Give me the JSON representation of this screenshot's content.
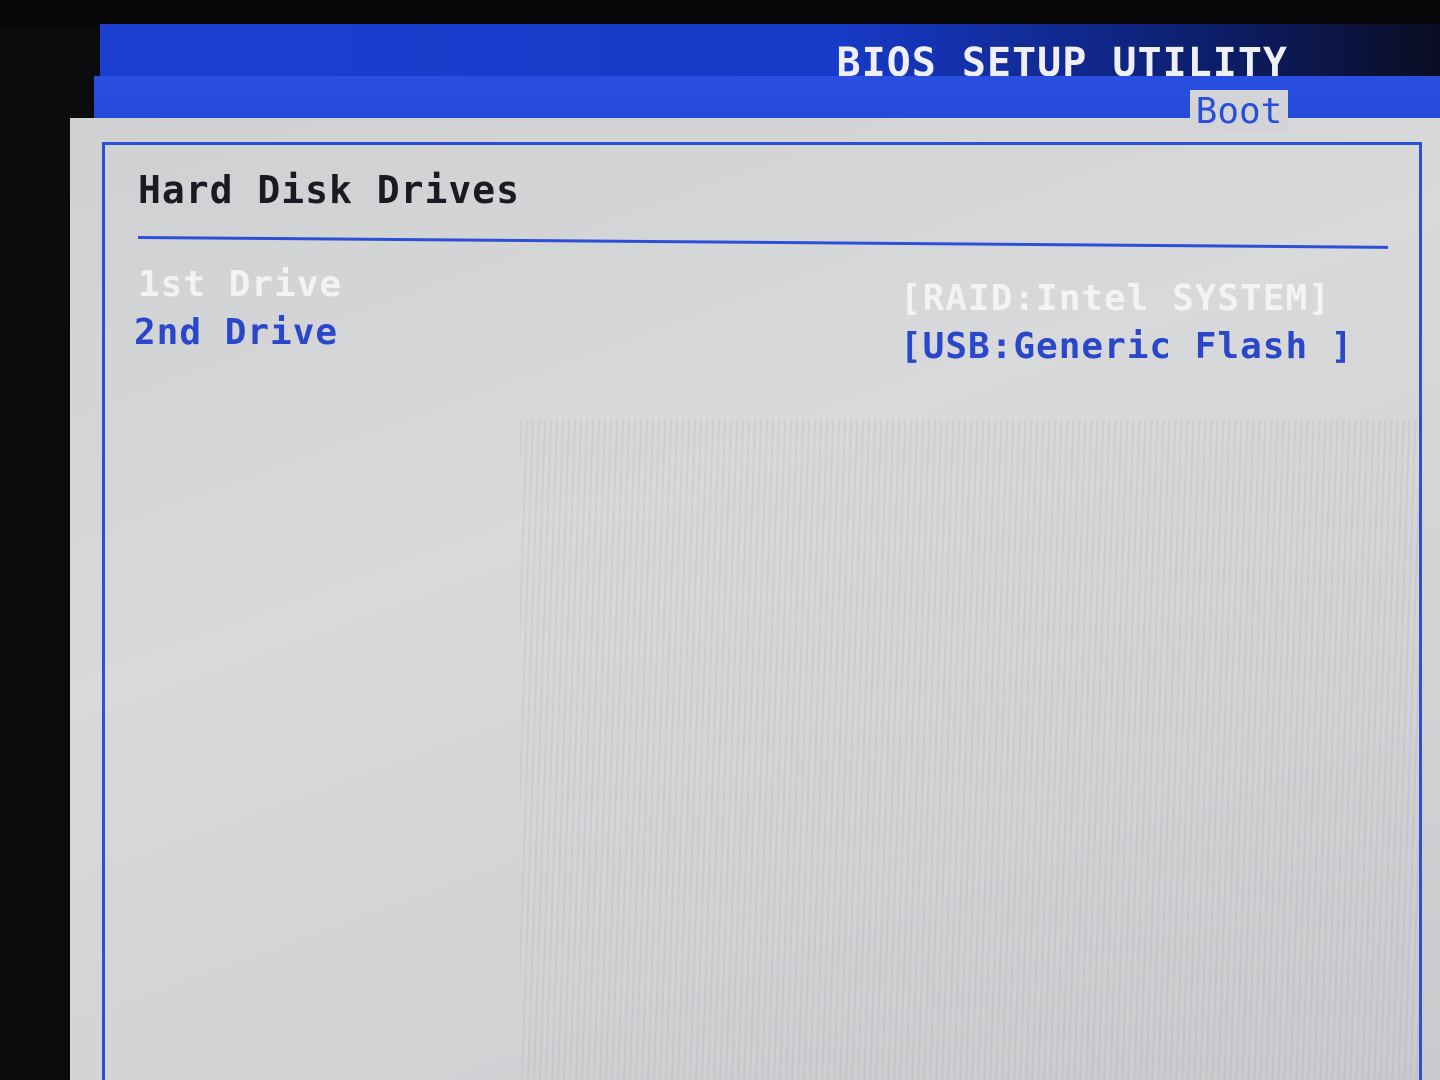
{
  "header": {
    "title": "BIOS SETUP UTILITY",
    "active_tab": "Boot"
  },
  "section": {
    "title": "Hard Disk Drives"
  },
  "drives": [
    {
      "label": "1st Drive",
      "value": "[RAID:Intel SYSTEM]",
      "selected": true
    },
    {
      "label": "2nd Drive",
      "value": "[USB:Generic Flash ]",
      "selected": false
    }
  ],
  "colors": {
    "accent_blue": "#2347d6",
    "panel_gray": "#d3d4d8",
    "selected_text": "#f3f3f5",
    "item_text": "#2a47c9"
  }
}
